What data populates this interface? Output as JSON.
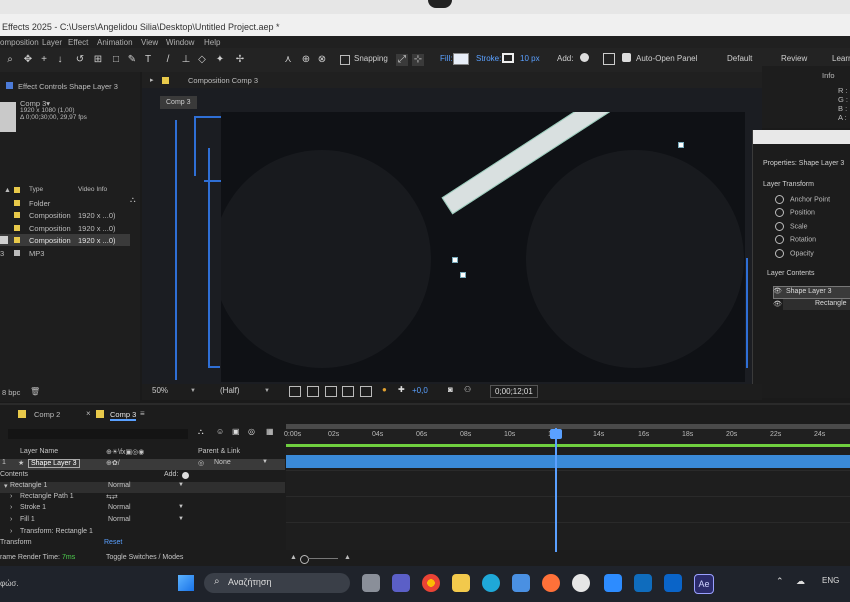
{
  "window": {
    "title": "Effects 2025 - C:\\Users\\Angelidou Silia\\Desktop\\Untitled Project.aep *"
  },
  "menu": [
    "omposition",
    "Layer",
    "Effect",
    "Animation",
    "View",
    "Window",
    "Help"
  ],
  "toolbar": {
    "snapping": "Snapping",
    "fill": "Fill:",
    "stroke": "Stroke:",
    "stroke_width": "10 px",
    "add": "Add:",
    "auto_open": "Auto-Open Panel",
    "workspaces": [
      "Default",
      "Review",
      "Learn"
    ]
  },
  "effect_controls": {
    "tab": "Effect Controls Shape Layer 3"
  },
  "comp_panel_tab": "Composition Comp 3",
  "comp_chip": "Comp 3",
  "info_tab": "Info",
  "info_letters": [
    "R :",
    "G :",
    "B :",
    "A :"
  ],
  "project": {
    "comp_name": "Comp 3▾",
    "comp_size": "1920 x 1080 (1,00)",
    "comp_duration": "Δ 0;00;30;00, 29,97 fps",
    "columns": [
      "Type",
      "Video Info"
    ],
    "items": [
      {
        "type": "Folder",
        "info": "",
        "color": "#e8c94a"
      },
      {
        "type": "Composition",
        "info": "1920 x ...0)",
        "color": "#e8c94a"
      },
      {
        "type": "Composition",
        "info": "1920 x ...0)",
        "color": "#e8c94a"
      },
      {
        "type": "Composition",
        "info": "1920 x ...0)",
        "color": "#e8c94a"
      },
      {
        "type": "MP3",
        "info": "",
        "color": "#bbbbbb"
      }
    ],
    "row_prefix": "3",
    "bpc": "8 bpc"
  },
  "properties": {
    "title": "Properties: Shape Layer 3",
    "transform_header": "Layer Transform",
    "transform_items": [
      "Anchor Point",
      "Position",
      "Scale",
      "Rotation",
      "Opacity"
    ],
    "contents_header": "Layer Contents",
    "contents_items": [
      "Shape Layer 3",
      "Rectangle"
    ]
  },
  "viewer_controls": {
    "zoom": "50%",
    "resolution": "(Half)",
    "exposure": "+0,0",
    "timecode": "0;00;12;01"
  },
  "timeline": {
    "tabs": [
      "Comp 2",
      "Comp 3"
    ],
    "header": {
      "layer_name": "Layer Name",
      "parent": "Parent & Link"
    },
    "layer": {
      "index": "1",
      "name": "Shape Layer 3",
      "parent": "None"
    },
    "contents": "Contents",
    "add": "Add:",
    "rows": [
      {
        "name": "Rectangle 1",
        "mode": "Normal"
      },
      {
        "name": "Rectangle Path 1",
        "mode": ""
      },
      {
        "name": "Stroke 1",
        "mode": "Normal"
      },
      {
        "name": "Fill 1",
        "mode": "Normal"
      },
      {
        "name": "Transform: Rectangle 1",
        "mode": ""
      }
    ],
    "transform": "Transform",
    "reset": "Reset",
    "render_label": "rame Render Time:",
    "render_value": "7ms",
    "toggle": "Toggle Switches / Modes",
    "ruler": [
      "0:00s",
      "02s",
      "04s",
      "06s",
      "08s",
      "10s",
      "12s",
      "14s",
      "16s",
      "18s",
      "20s",
      "22s",
      "24s"
    ]
  },
  "taskbar": {
    "search": "Αναζήτηση",
    "lang": "ENG",
    "left_text": "φώσ."
  }
}
